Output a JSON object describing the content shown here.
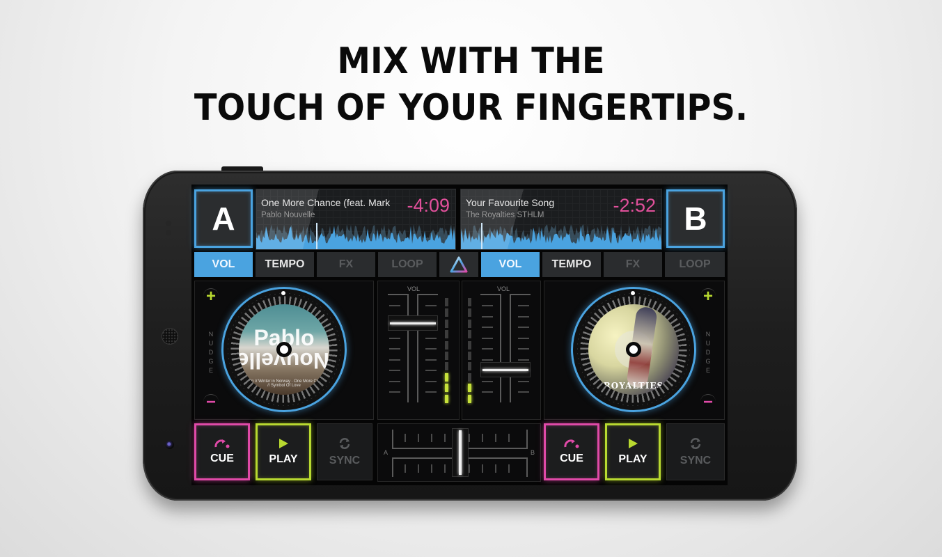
{
  "headline": {
    "line1": "MIX WITH THE",
    "line2": "TOUCH OF YOUR FINGERTIPS."
  },
  "colors": {
    "accent_blue": "#4aa3e0",
    "cue_pink": "#e04aa8",
    "play_green": "#b8d930",
    "time_pink": "#e1509b"
  },
  "deck_a": {
    "letter": "A",
    "track_title": "One More Chance (feat. Mark",
    "artist": "Pablo Nouvelle",
    "time_remaining": "-4:09",
    "playhead_progress": 0.3,
    "tabs": [
      {
        "label": "VOL",
        "state": "active"
      },
      {
        "label": "TEMPO",
        "state": "normal"
      },
      {
        "label": "FX",
        "state": "disabled"
      },
      {
        "label": "LOOP",
        "state": "disabled"
      }
    ],
    "nudge_label": "NUDGE",
    "nudge_plus": "+",
    "nudge_minus": "−",
    "album_art_text": "Pablo",
    "album_art_text_mirrored": "Nouvelle",
    "album_tracklist": "In It On // Winter in Norway · One More Chance // Symbol Of Love",
    "volume_fader_level": 0.75,
    "meter_level": 3,
    "pads": {
      "cue": "CUE",
      "play": "PLAY",
      "sync": "SYNC"
    }
  },
  "deck_b": {
    "letter": "B",
    "track_title": "Your Favourite Song",
    "artist": "The Royalties STHLM",
    "time_remaining": "-2:52",
    "playhead_progress": 0.1,
    "tabs": [
      {
        "label": "VOL",
        "state": "active"
      },
      {
        "label": "TEMPO",
        "state": "normal"
      },
      {
        "label": "FX",
        "state": "disabled"
      },
      {
        "label": "LOOP",
        "state": "disabled"
      }
    ],
    "nudge_label": "NUDGE",
    "nudge_plus": "+",
    "nudge_minus": "−",
    "album_art_text": "ROYALTIES",
    "volume_fader_level": 0.3,
    "meter_level": 2,
    "pads": {
      "cue": "CUE",
      "play": "PLAY",
      "sync": "SYNC"
    }
  },
  "mixer": {
    "vol_label_left": "VOL",
    "vol_label_right": "VOL",
    "crossfader_left": "A",
    "crossfader_right": "B",
    "crossfader_position": 0.5,
    "meter_segments": 10,
    "logo_icon": "triangle-logo-icon"
  }
}
